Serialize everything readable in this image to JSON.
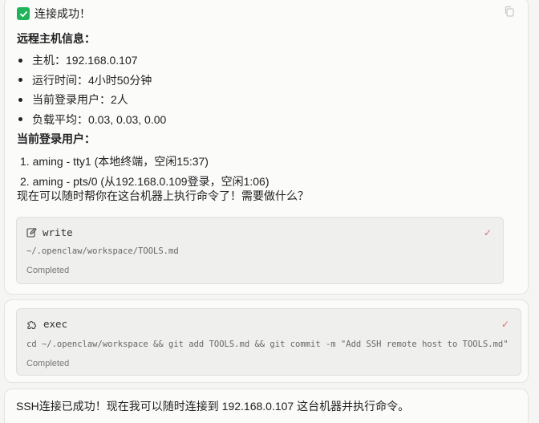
{
  "message1": {
    "status_text": "连接成功！",
    "host_info_heading": "远程主机信息：",
    "host_info": [
      "主机：192.168.0.107",
      "运行时间：4小时50分钟",
      "当前登录用户：2人",
      "负载平均：0.03, 0.03, 0.00"
    ],
    "users_heading": "当前登录用户：",
    "users": [
      "1. aming - tty1 (本地终端，空闲15:37)",
      "2. aming - pts/0 (从192.168.0.109登录，空闲1:06)"
    ],
    "followup": "现在可以随时帮你在这台机器上执行命令了！需要做什么？",
    "tool": {
      "name": "write",
      "icon": "edit-icon",
      "path": "~/.openclaw/workspace/TOOLS.md",
      "status": "Completed"
    }
  },
  "message2": {
    "tool": {
      "name": "exec",
      "icon": "puzzle-icon",
      "command": "cd ~/.openclaw/workspace && git add TOOLS.md && git commit -m \"Add SSH remote host to TOOLS.md\"",
      "status": "Completed"
    }
  },
  "message3": {
    "text": "SSH连接已成功！现在我可以随时连接到 192.168.0.107 这台机器并执行命令。"
  },
  "colors": {
    "success_green": "#21b35a",
    "tick_red": "#e06c6c",
    "card_bg": "#fbfbfa",
    "tool_bg": "#efefee"
  }
}
